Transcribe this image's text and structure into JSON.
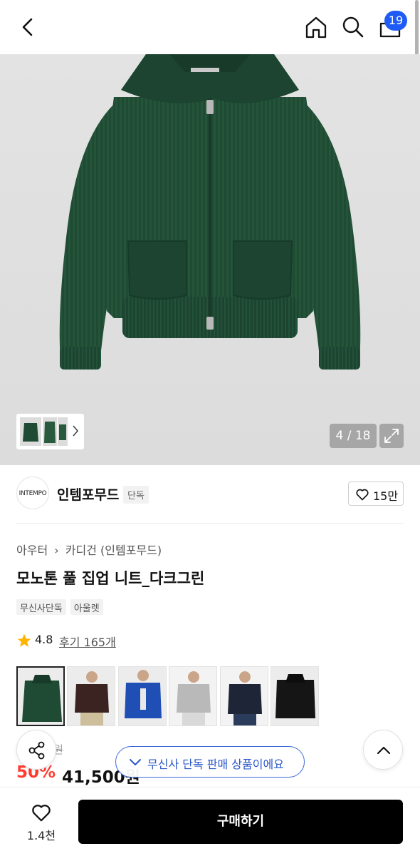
{
  "header": {
    "icons": [
      "back-icon",
      "home-icon",
      "search-icon",
      "bag-icon"
    ],
    "cart_badge": "19"
  },
  "gallery": {
    "pager": "4 / 18",
    "accent": "#1f4a33"
  },
  "brand": {
    "logo_text": "INTEMPO",
    "name": "인템포무드",
    "tag": "단독",
    "likes": "15만"
  },
  "product": {
    "breadcrumb_parent": "아우터",
    "breadcrumb_child": "카디건 (인템포무드)",
    "title": "모노톤 풀 집업 니트_다크그린",
    "tags": [
      "무신사단독",
      "아울렛"
    ],
    "rating": "4.8",
    "reviews": "후기 165개",
    "variants": [
      {
        "color": "#1f4a33"
      },
      {
        "color": "#3a2320"
      },
      {
        "color": "#1f4fb5"
      },
      {
        "color": "#b9b9b9"
      },
      {
        "color": "#1d2536"
      },
      {
        "color": "#151515"
      }
    ]
  },
  "price": {
    "original": "원",
    "discount": "50%",
    "current": "41,500원"
  },
  "floating": {
    "exclusive_text": "무신사 단독 판매 상품이에요"
  },
  "bottom": {
    "wish_count": "1.4천",
    "buy_label": "구매하기"
  },
  "colors": {
    "accent_blue": "#1f5cf5",
    "sale_red": "#ff3b30",
    "buy_black": "#000000"
  }
}
